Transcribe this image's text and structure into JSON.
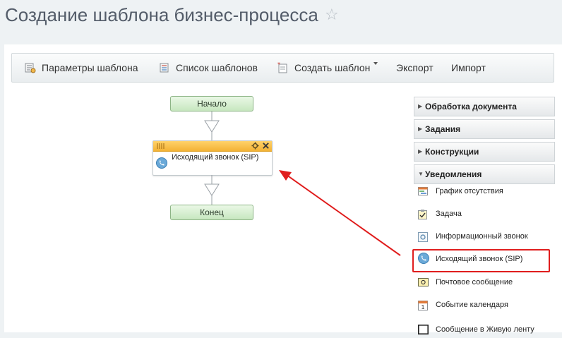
{
  "page": {
    "title": "Создание шаблона бизнес-процесса",
    "star_icon": "star-outline-icon"
  },
  "toolbar": {
    "template_params": "Параметры шаблона",
    "template_list": "Список шаблонов",
    "create_template": "Создать шаблон",
    "export": "Экспорт",
    "import": "Импорт"
  },
  "flow": {
    "start_label": "Начало",
    "activity_label": "Исходящий звонок (SIP)",
    "end_label": "Конец",
    "activity_header_color": "#f5b93b",
    "node_color": "#d4efcd"
  },
  "panel": {
    "sections": [
      {
        "label": "Обработка документа",
        "expanded": false
      },
      {
        "label": "Задания",
        "expanded": false
      },
      {
        "label": "Конструкции",
        "expanded": false
      },
      {
        "label": "Уведомления",
        "expanded": true
      }
    ],
    "items": [
      {
        "label": "График отсутствия",
        "icon": "absence-chart-icon"
      },
      {
        "label": "Задача",
        "icon": "task-icon"
      },
      {
        "label": "Информационный звонок",
        "icon": "info-call-icon"
      },
      {
        "label": "Исходящий звонок (SIP)",
        "icon": "phone-icon",
        "highlighted": true
      },
      {
        "label": "Почтовое сообщение",
        "icon": "mail-icon"
      },
      {
        "label": "Событие календаря",
        "icon": "calendar-icon"
      },
      {
        "label": "Сообщение в Живую ленту",
        "icon": "feed-message-icon"
      }
    ]
  },
  "colors": {
    "highlight": "#e01e1e",
    "annotation_arrow": "#e01e1e"
  }
}
